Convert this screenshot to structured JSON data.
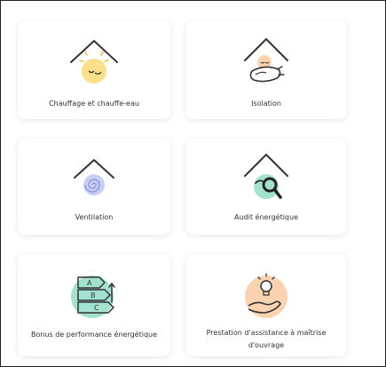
{
  "services": [
    {
      "label": "Chauffage et chauffe-eau",
      "icon": "heating-house-sun-icon"
    },
    {
      "label": "Isolation",
      "icon": "insulation-house-icon"
    },
    {
      "label": "Ventilation",
      "icon": "ventilation-house-spiral-icon"
    },
    {
      "label": "Audit énergétique",
      "icon": "energy-audit-house-icon"
    },
    {
      "label": "Bonus de performance énergétique",
      "icon": "energy-rating-arrows-icon"
    },
    {
      "label": "Prestation d'assistance à maîtrise d'ouvrage",
      "icon": "hand-lightbulb-icon"
    }
  ],
  "colors": {
    "yellow": "#fbdf8a",
    "mint": "#a3e2cf",
    "lavender": "#c9cef3",
    "peach": "#fbd3b0",
    "ink": "#333333"
  }
}
